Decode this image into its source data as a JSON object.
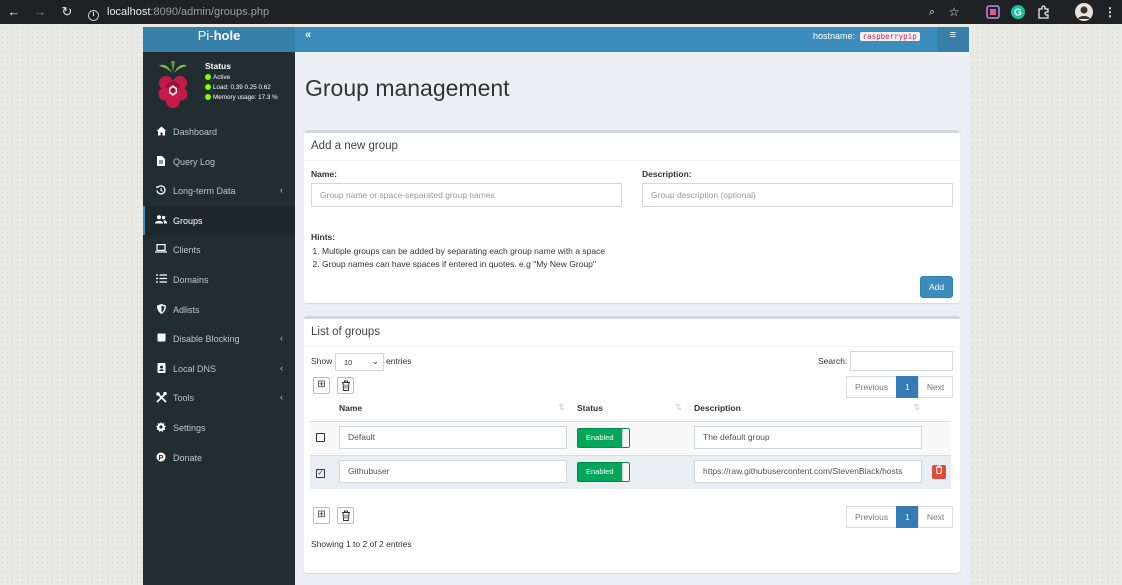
{
  "browser": {
    "url_host": "localhost",
    "url_rest": ":8090/admin/groups.php"
  },
  "topbar": {
    "brand_prefix": "Pi-",
    "brand_name": "hole",
    "collapse_glyph": "«",
    "hostname_label": "hostname:",
    "hostname_value": "raspberrypip",
    "menu_glyph": "≡"
  },
  "status": {
    "title": "Status",
    "active": "Active",
    "load": "Load: 0.39  0.25  0.62",
    "memory": "Memory usage:  17.3 %",
    "dot_color": "#7fff00"
  },
  "sidebar": {
    "items": [
      {
        "label": "Dashboard",
        "icon": "home-icon"
      },
      {
        "label": "Query Log",
        "icon": "file-icon"
      },
      {
        "label": "Long-term Data",
        "icon": "history-icon"
      },
      {
        "label": "Groups",
        "icon": "users-icon"
      },
      {
        "label": "Clients",
        "icon": "laptop-icon"
      },
      {
        "label": "Domains",
        "icon": "list-icon"
      },
      {
        "label": "Adlists",
        "icon": "shield-icon"
      },
      {
        "label": "Disable Blocking",
        "icon": "stop-icon"
      },
      {
        "label": "Local DNS",
        "icon": "address-book-icon"
      },
      {
        "label": "Tools",
        "icon": "tools-icon"
      },
      {
        "label": "Settings",
        "icon": "gear-icon"
      },
      {
        "label": "Donate",
        "icon": "paypal-icon"
      }
    ]
  },
  "page": {
    "title": "Group management"
  },
  "add_group": {
    "title": "Add a new group",
    "name_label": "Name:",
    "name_placeholder": "Group name or space-separated group names",
    "description_label": "Description:",
    "description_placeholder": "Group description (optional)",
    "hints_label": "Hints:",
    "hints": [
      "Multiple groups can be added by separating each group name with a space",
      "Group names can have spaces if entered in quotes. e.g \"My New Group\""
    ],
    "add_button": "Add"
  },
  "list": {
    "title": "List of groups",
    "show_label": "Show",
    "entries_value": "10",
    "entries_label": "entries",
    "search_label": "Search:",
    "pagination": {
      "previous": "Previous",
      "current": "1",
      "next": "Next"
    },
    "columns": {
      "name": "Name",
      "status": "Status",
      "description": "Description"
    },
    "rows": [
      {
        "checked": false,
        "name": "Default",
        "status": "Enabled",
        "description": "The default group"
      },
      {
        "checked": true,
        "name": "Githubuser",
        "status": "Enabled",
        "description": "https://raw.githubusercontent.com/StevenBlack/hosts"
      }
    ],
    "footer_info": "Showing 1 to 2 of 2 entries"
  },
  "colors": {
    "header_blue": "#3c8dbc",
    "sidebar_dark": "#222d32",
    "enabled_green": "#00a65a",
    "delete_red": "#dd4b39"
  }
}
